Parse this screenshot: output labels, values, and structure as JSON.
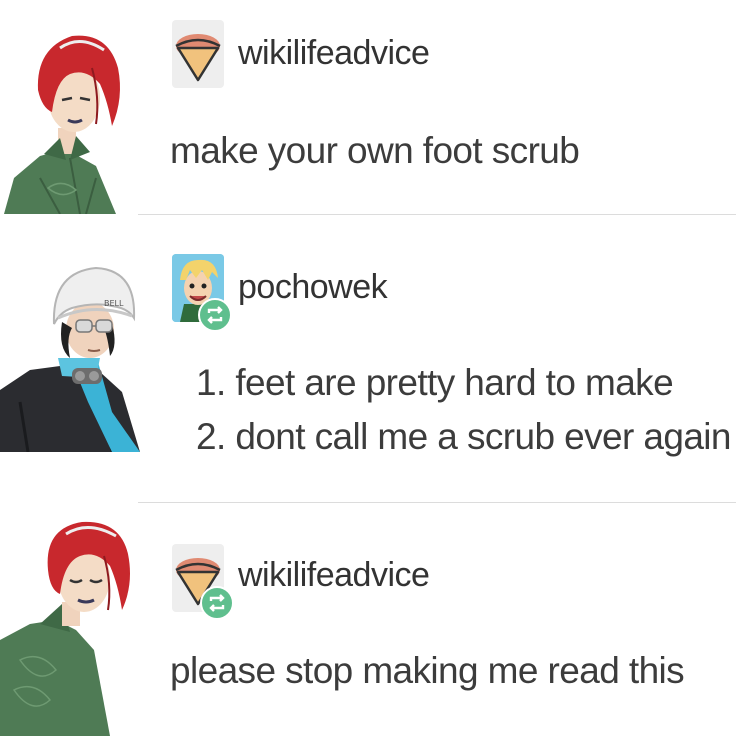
{
  "posts": [
    {
      "username": "wikilifeadvice",
      "avatar_icon": "ice-cream-cone-icon",
      "reblogged": false,
      "character_icon": "red-haired-character-smirk",
      "text": "make your own foot scrub"
    },
    {
      "username": "pochowek",
      "avatar_icon": "cartoon-blonde-boy-avatar",
      "reblogged": true,
      "character_icon": "helmet-character",
      "list": [
        "1. feet are pretty hard to make",
        "2. dont call me a scrub ever again"
      ]
    },
    {
      "username": "wikilifeadvice",
      "avatar_icon": "ice-cream-cone-icon",
      "reblogged": true,
      "character_icon": "red-haired-character-eyes-closed",
      "text": "please stop making me read this"
    }
  ],
  "colors": {
    "reblog_badge": "#5fbf8e",
    "divider": "#dcdcdc",
    "text": "#3c3c3c",
    "character_hair": "#c8282d",
    "character_jacket": "#4f7b55"
  }
}
